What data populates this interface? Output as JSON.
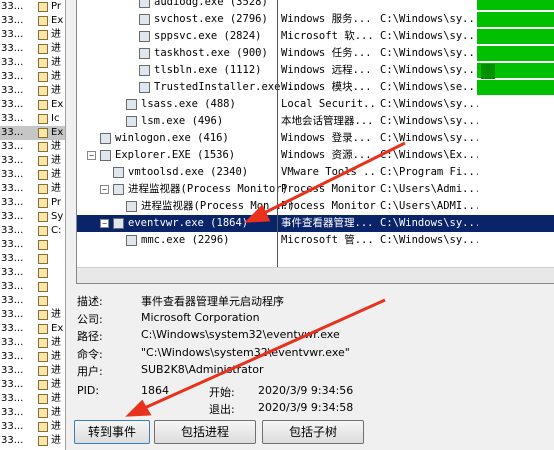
{
  "left_strip": {
    "rows": [
      {
        "num": "33...",
        "txt": "Pr"
      },
      {
        "num": "33...",
        "txt": "Ex"
      },
      {
        "num": "33...",
        "txt": "进"
      },
      {
        "num": "33...",
        "txt": "进"
      },
      {
        "num": "33...",
        "txt": "进"
      },
      {
        "num": "33...",
        "txt": "进"
      },
      {
        "num": "33...",
        "txt": "进"
      },
      {
        "num": "33...",
        "txt": "Ex"
      },
      {
        "num": "33...",
        "txt": "Ic"
      },
      {
        "num": "33...",
        "txt": "Ex"
      },
      {
        "num": "33...",
        "txt": "进"
      },
      {
        "num": "33...",
        "txt": "进"
      },
      {
        "num": "33...",
        "txt": "进"
      },
      {
        "num": "33...",
        "txt": "进"
      },
      {
        "num": "33...",
        "txt": "Pr"
      },
      {
        "num": "33...",
        "txt": "Sy"
      },
      {
        "num": "33...",
        "txt": "C:"
      },
      {
        "num": "33...",
        "txt": ""
      },
      {
        "num": "33...",
        "txt": ""
      },
      {
        "num": "33...",
        "txt": ""
      },
      {
        "num": "33...",
        "txt": ""
      },
      {
        "num": "33...",
        "txt": ""
      },
      {
        "num": "33...",
        "txt": "进"
      },
      {
        "num": "33...",
        "txt": "Ex"
      },
      {
        "num": "33...",
        "txt": "进"
      },
      {
        "num": "33...",
        "txt": "进"
      },
      {
        "num": "33...",
        "txt": "进"
      },
      {
        "num": "33...",
        "txt": "进"
      },
      {
        "num": "33...",
        "txt": "进"
      },
      {
        "num": "33...",
        "txt": "进"
      },
      {
        "num": "33...",
        "txt": "进"
      },
      {
        "num": "33...",
        "txt": "进"
      }
    ]
  },
  "processes": [
    {
      "name": "audiodg.exe (3528)",
      "desc": "",
      "path": "",
      "indent": 4
    },
    {
      "name": "svchost.exe (2796)",
      "desc": "Windows 服务...",
      "path": "C:\\Windows\\sy...",
      "indent": 4
    },
    {
      "name": "sppsvc.exe (2824)",
      "desc": "Microsoft 软...",
      "path": "C:\\Windows\\sy...",
      "indent": 4
    },
    {
      "name": "taskhost.exe (900)",
      "desc": "Windows 任务...",
      "path": "C:\\Windows\\sy...",
      "indent": 4
    },
    {
      "name": "tlsbln.exe (1112)",
      "desc": "Windows 远程...",
      "path": "C:\\Windows\\sy...",
      "indent": 4
    },
    {
      "name": "TrustedInstaller.exe ...",
      "desc": "Windows 模块...",
      "path": "C:\\Windows\\se...",
      "indent": 4
    },
    {
      "name": "lsass.exe (488)",
      "desc": "Local Securit...",
      "path": "C:\\Windows\\sy...",
      "indent": 3
    },
    {
      "name": "lsm.exe (496)",
      "desc": "本地会话管理器...",
      "path": "C:\\Windows\\sy...",
      "indent": 3
    },
    {
      "name": "winlogon.exe (416)",
      "desc": "Windows 登录...",
      "path": "C:\\Windows\\sy...",
      "indent": 1
    },
    {
      "name": "Explorer.EXE (1536)",
      "desc": "Windows 资源...",
      "path": "C:\\Windows\\Ex...",
      "indent": 1
    },
    {
      "name": "vmtoolsd.exe (2340)",
      "desc": "VMware Tools ...",
      "path": "C:\\Program Fi...",
      "indent": 2
    },
    {
      "name": "进程监视器(Process Monitor)",
      "desc": "Process Monitor",
      "path": "C:\\Users\\Admi...",
      "indent": 2
    },
    {
      "name": "进程监视器(Process Mon...)",
      "desc": "Process Monitor",
      "path": "C:\\Users\\ADMI...",
      "indent": 3
    },
    {
      "name": "eventvwr.exe (1864)",
      "desc": "事件查看器管理...",
      "path": "C:\\Windows\\sy...",
      "indent": 2,
      "selected": true
    },
    {
      "name": "mmc.exe (2296)",
      "desc": "Microsoft 管...",
      "path": "C:\\Windows\\sy...",
      "indent": 3
    }
  ],
  "cpu": [
    {
      "row": 0,
      "w": 78
    },
    {
      "row": 1,
      "w": 78
    },
    {
      "row": 2,
      "w": 78
    },
    {
      "row": 3,
      "w": 78
    },
    {
      "row": 4,
      "w": 78
    },
    {
      "row": 5,
      "w": 78
    }
  ],
  "details": {
    "desc_label": "描述:",
    "desc_value": "事件查看器管理单元启动程序",
    "company_label": "公司:",
    "company_value": "Microsoft Corporation",
    "path_label": "路径:",
    "path_value": "C:\\Windows\\system32\\eventvwr.exe",
    "cmd_label": "命令:",
    "cmd_value": "\"C:\\Windows\\system32\\eventvwr.exe\"",
    "user_label": "用户:",
    "user_value": "SUB2K8\\Administrator",
    "pid_label": "PID:",
    "pid_value": "1864",
    "start_label": "开始:",
    "start_value": "2020/3/9 9:34:56",
    "exit_label": "退出:",
    "exit_value": "2020/3/9 9:34:58"
  },
  "buttons": {
    "goto_event": "转到事件",
    "include_process": "包括进程",
    "include_subtree": "包括子树"
  },
  "colors": {
    "selection": "#0a246a",
    "cpu_bar": "#00c000",
    "annotation_arrow": "#e8321e"
  }
}
